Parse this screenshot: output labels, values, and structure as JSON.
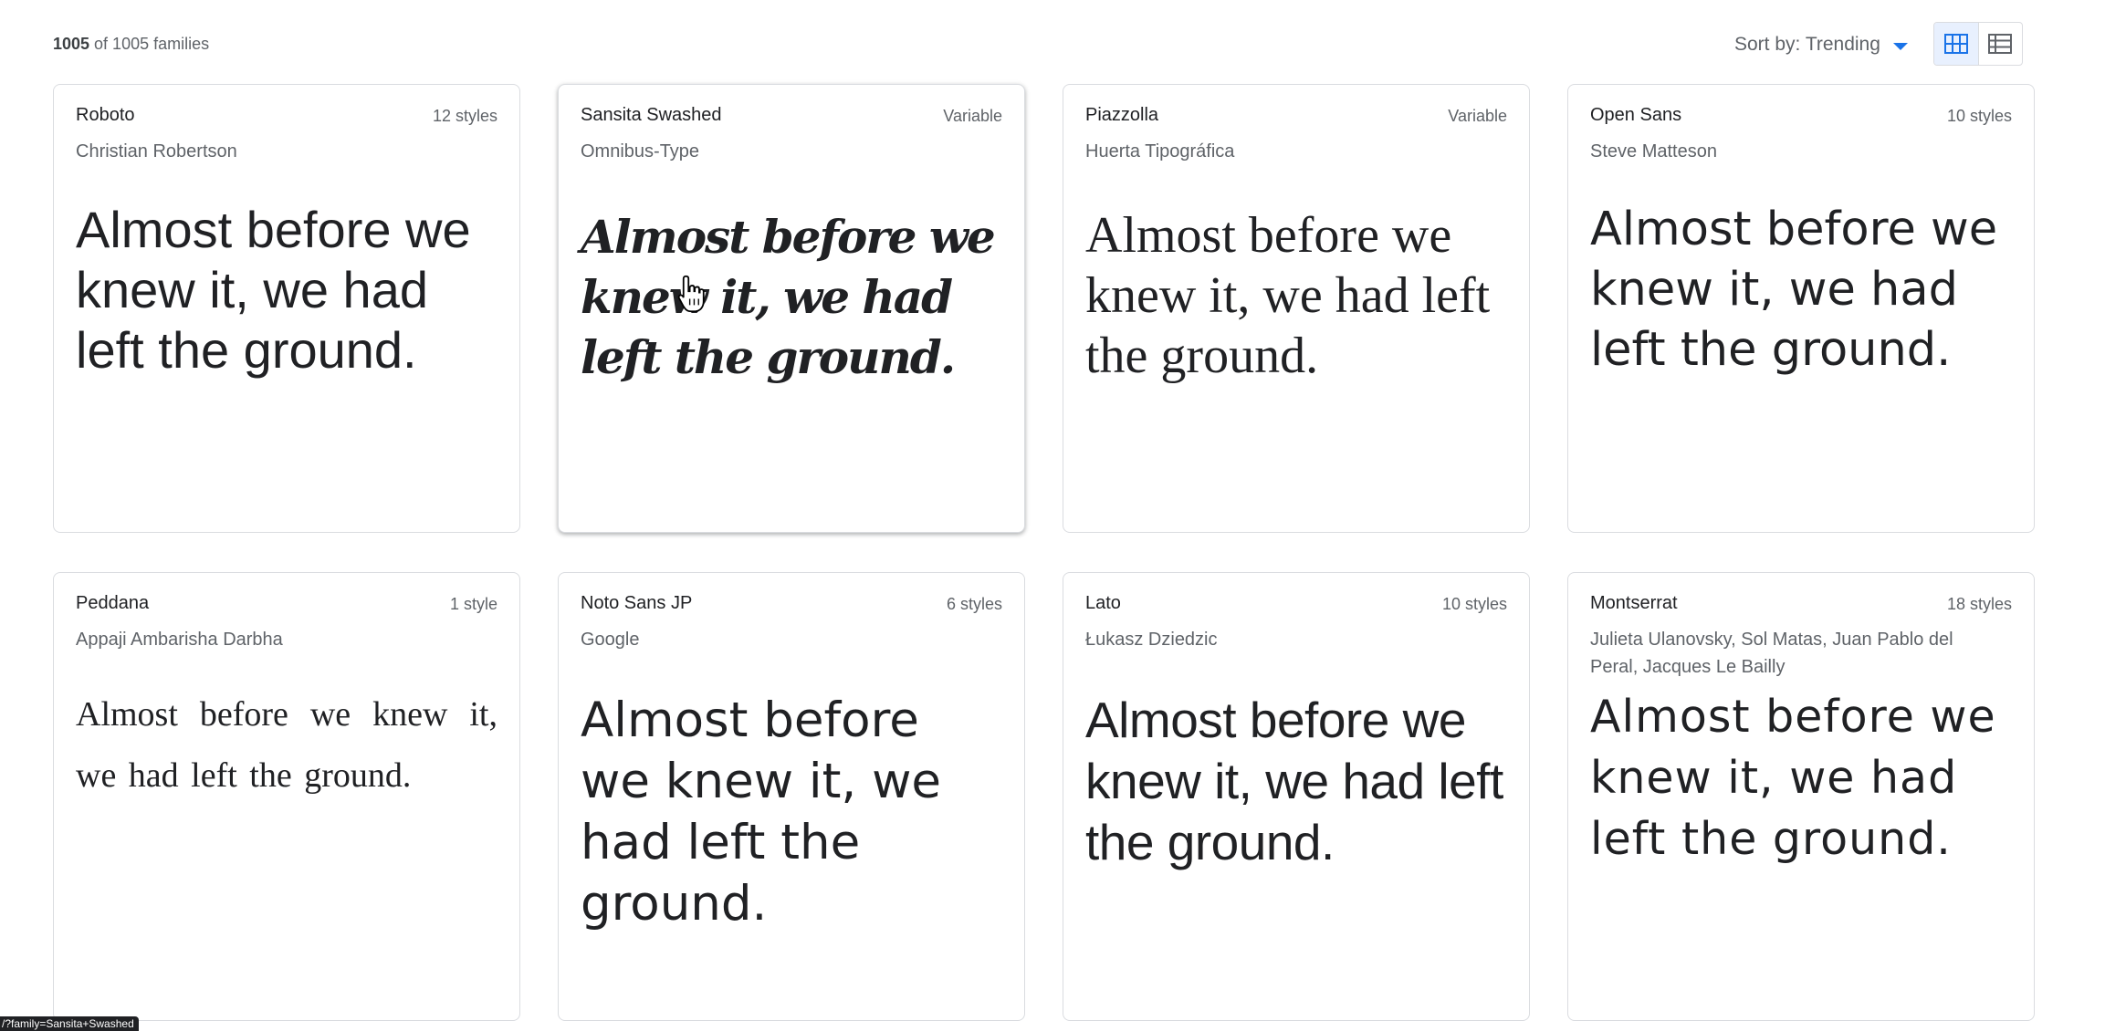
{
  "results": {
    "shown": "1005",
    "rest": " of 1005 families"
  },
  "sort": {
    "label": "Sort by: Trending"
  },
  "view_toggle": {
    "grid_icon": "grid-view-icon",
    "list_icon": "list-view-icon"
  },
  "status_url": "/?family=Sansita+Swashed",
  "preview_text": "Almost before we knew it, we had left the ground.",
  "cursor_icon": "hand-pointer-icon",
  "cards": [
    {
      "name": "Roboto",
      "styles": "12 styles",
      "designer": "Christian Robertson"
    },
    {
      "name": "Sansita Swashed",
      "styles": "Variable",
      "designer": "Omnibus-Type"
    },
    {
      "name": "Piazzolla",
      "styles": "Variable",
      "designer": "Huerta Tipográfica"
    },
    {
      "name": "Open Sans",
      "styles": "10 styles",
      "designer": "Steve Matteson"
    },
    {
      "name": "Peddana",
      "styles": "1 style",
      "designer": "Appaji Ambarisha Darbha"
    },
    {
      "name": "Noto Sans JP",
      "styles": "6 styles",
      "designer": "Google"
    },
    {
      "name": "Lato",
      "styles": "10 styles",
      "designer": "Łukasz Dziedzic"
    },
    {
      "name": "Montserrat",
      "styles": "18 styles",
      "designer": "Julieta Ulanovsky, Sol Matas, Juan Pablo del Peral, Jacques Le Bailly"
    }
  ]
}
